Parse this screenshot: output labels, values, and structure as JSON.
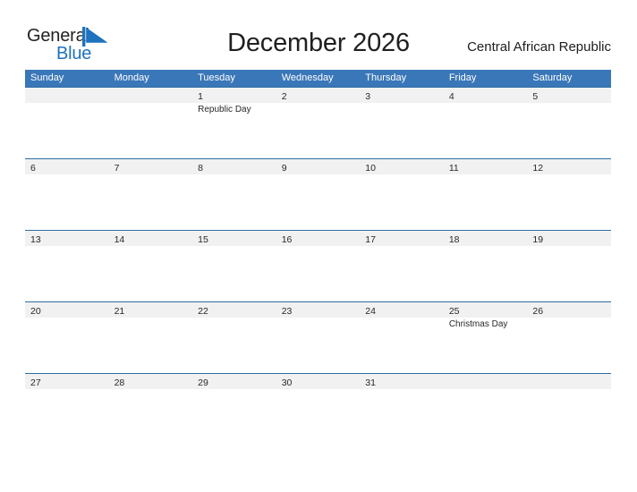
{
  "brand": {
    "name_part1": "General",
    "name_part2": "Blue",
    "flag_icon": "blue-triangle-flag-icon",
    "accent_color": "#1f72bd"
  },
  "header": {
    "title": "December 2026",
    "region": "Central African Republic"
  },
  "theme": {
    "header_bar_color": "#3a77b8",
    "row_border_color": "#2e6da4",
    "band_color": "#f1f1f1",
    "text_color": "#282828"
  },
  "calendar": {
    "month": "December",
    "year": "2026",
    "weekday_headers": [
      "Sunday",
      "Monday",
      "Tuesday",
      "Wednesday",
      "Thursday",
      "Friday",
      "Saturday"
    ],
    "weeks": [
      [
        {
          "day": "",
          "event": ""
        },
        {
          "day": "",
          "event": ""
        },
        {
          "day": "1",
          "event": "Republic Day"
        },
        {
          "day": "2",
          "event": ""
        },
        {
          "day": "3",
          "event": ""
        },
        {
          "day": "4",
          "event": ""
        },
        {
          "day": "5",
          "event": ""
        }
      ],
      [
        {
          "day": "6",
          "event": ""
        },
        {
          "day": "7",
          "event": ""
        },
        {
          "day": "8",
          "event": ""
        },
        {
          "day": "9",
          "event": ""
        },
        {
          "day": "10",
          "event": ""
        },
        {
          "day": "11",
          "event": ""
        },
        {
          "day": "12",
          "event": ""
        }
      ],
      [
        {
          "day": "13",
          "event": ""
        },
        {
          "day": "14",
          "event": ""
        },
        {
          "day": "15",
          "event": ""
        },
        {
          "day": "16",
          "event": ""
        },
        {
          "day": "17",
          "event": ""
        },
        {
          "day": "18",
          "event": ""
        },
        {
          "day": "19",
          "event": ""
        }
      ],
      [
        {
          "day": "20",
          "event": ""
        },
        {
          "day": "21",
          "event": ""
        },
        {
          "day": "22",
          "event": ""
        },
        {
          "day": "23",
          "event": ""
        },
        {
          "day": "24",
          "event": ""
        },
        {
          "day": "25",
          "event": "Christmas Day"
        },
        {
          "day": "26",
          "event": ""
        }
      ],
      [
        {
          "day": "27",
          "event": ""
        },
        {
          "day": "28",
          "event": ""
        },
        {
          "day": "29",
          "event": ""
        },
        {
          "day": "30",
          "event": ""
        },
        {
          "day": "31",
          "event": ""
        },
        {
          "day": "",
          "event": ""
        },
        {
          "day": "",
          "event": ""
        }
      ]
    ]
  }
}
